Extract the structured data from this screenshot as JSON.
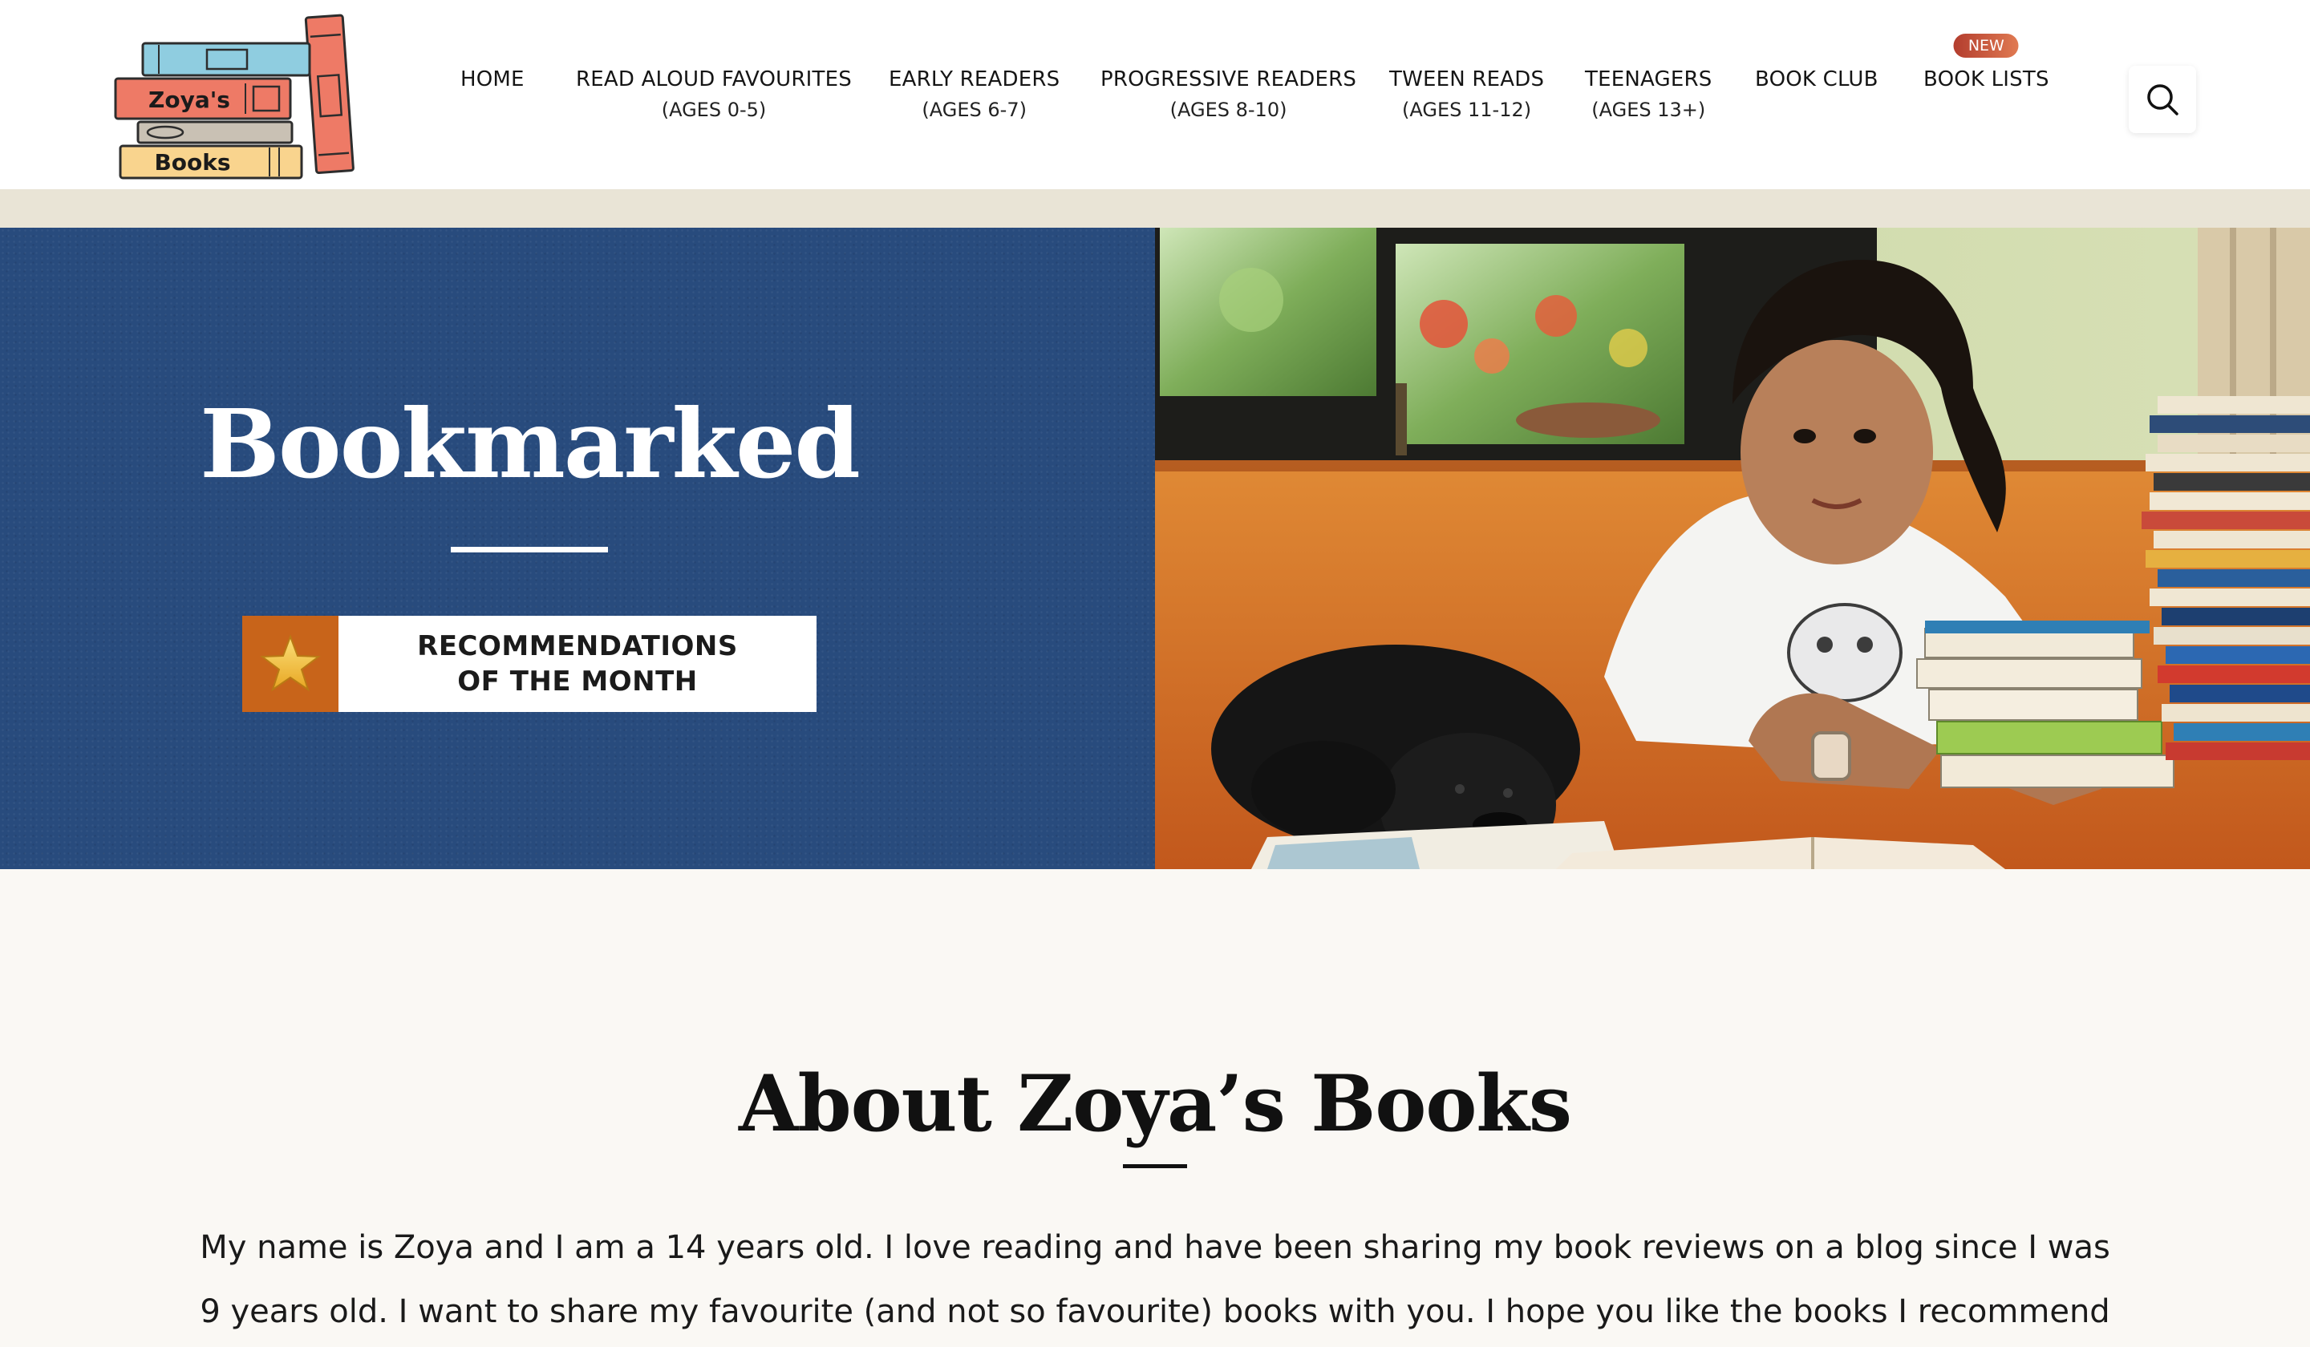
{
  "header": {
    "logo": {
      "line1": "Zoya's",
      "line2": "Books",
      "colors": {
        "blue_book": "#8fcde0",
        "red_book": "#ee7a66",
        "gray_book": "#c9c1b4",
        "yellow_book": "#f9d48e",
        "outline": "#2d2d2d"
      }
    },
    "nav": [
      {
        "label": "HOME",
        "sub": ""
      },
      {
        "label": "READ ALOUD FAVOURITES",
        "sub": "(AGES 0-5)"
      },
      {
        "label": "EARLY READERS",
        "sub": "(AGES 6-7)"
      },
      {
        "label": "PROGRESSIVE READERS",
        "sub": "(AGES 8-10)"
      },
      {
        "label": "TWEEN READS",
        "sub": "(AGES 11-12)"
      },
      {
        "label": "TEENAGERS",
        "sub": "(AGES 13+)"
      },
      {
        "label": "BOOK CLUB",
        "sub": ""
      },
      {
        "label": "BOOK LISTS",
        "sub": "",
        "badge": "NEW"
      }
    ],
    "search_icon": "search-icon"
  },
  "hero": {
    "title": "Bookmarked",
    "recommendation": {
      "line1": "RECOMMENDATIONS",
      "line2": "OF THE MONTH",
      "icon": "star-icon"
    },
    "colors": {
      "panel": "#284b7d",
      "star_bg": "#c8641a"
    }
  },
  "about": {
    "title": "About Zoya’s Books",
    "paragraph_line1": "My name is Zoya and I am a 14 years old. I love reading and have been sharing my book reviews on a blog since I was",
    "paragraph_line2": "9 years old. I want to share my favourite (and not so favourite) books with you. I hope you like the books I recommend"
  }
}
